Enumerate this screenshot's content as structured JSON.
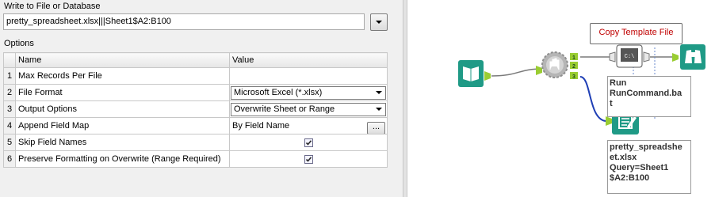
{
  "config": {
    "write_label": "Write to File or Database",
    "path_value": "pretty_spreadsheet.xlsx|||Sheet1$A2:B100",
    "options_label": "Options",
    "headers": {
      "name": "Name",
      "value": "Value"
    },
    "rows": [
      {
        "num": "1",
        "name": "Max Records Per File",
        "value": ""
      },
      {
        "num": "2",
        "name": "File Format",
        "value": "Microsoft Excel (*.xlsx)"
      },
      {
        "num": "3",
        "name": "Output Options",
        "value": "Overwrite Sheet or Range"
      },
      {
        "num": "4",
        "name": "Append Field Map",
        "value": "By Field Name",
        "button": "..."
      },
      {
        "num": "5",
        "name": "Skip Field Names",
        "checked": true
      },
      {
        "num": "6",
        "name": "Preserve Formatting on Overwrite (Range Required)",
        "checked": true
      }
    ]
  },
  "canvas": {
    "copy_template_label": "Copy Template File",
    "runcommand_annotation_lines": [
      "Run",
      "RunCommand.ba",
      "t"
    ],
    "output_annotation_lines": [
      "pretty_spreadshe",
      "et.xlsx",
      "Query=Sheet1",
      "$A2:B100"
    ],
    "output_anchor_labels": [
      "1",
      "2",
      "3"
    ],
    "run_command_icon_text": "C:\\",
    "colors": {
      "input_tool": "#2a9d8f",
      "output_tool": "#27a08c",
      "block_until_done": "#b9b9b9",
      "connection": "#7a7a7a",
      "connection_selected": "#1f3fb5",
      "anchor": "#9acd32",
      "label_red": "#c00000"
    }
  }
}
